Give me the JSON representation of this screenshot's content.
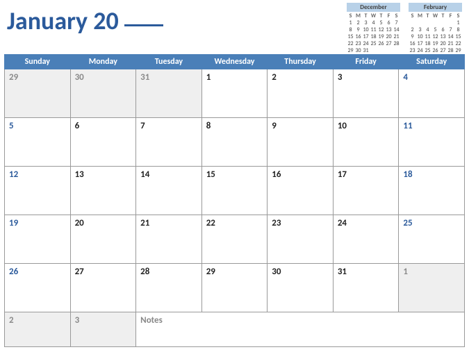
{
  "title_month": "January",
  "title_year_prefix": "20",
  "dow": [
    "Sunday",
    "Monday",
    "Tuesday",
    "Wednesday",
    "Thursday",
    "Friday",
    "Saturday"
  ],
  "dow_short": [
    "S",
    "M",
    "T",
    "W",
    "T",
    "F",
    "S"
  ],
  "weeks": [
    [
      {
        "n": "29",
        "t": "other"
      },
      {
        "n": "30",
        "t": "other"
      },
      {
        "n": "31",
        "t": "other"
      },
      {
        "n": "1",
        "t": "wkdy"
      },
      {
        "n": "2",
        "t": "wkdy"
      },
      {
        "n": "3",
        "t": "wkdy"
      },
      {
        "n": "4",
        "t": "wknd"
      }
    ],
    [
      {
        "n": "5",
        "t": "wknd"
      },
      {
        "n": "6",
        "t": "wkdy"
      },
      {
        "n": "7",
        "t": "wkdy"
      },
      {
        "n": "8",
        "t": "wkdy"
      },
      {
        "n": "9",
        "t": "wkdy"
      },
      {
        "n": "10",
        "t": "wkdy"
      },
      {
        "n": "11",
        "t": "wknd"
      }
    ],
    [
      {
        "n": "12",
        "t": "wknd"
      },
      {
        "n": "13",
        "t": "wkdy"
      },
      {
        "n": "14",
        "t": "wkdy"
      },
      {
        "n": "15",
        "t": "wkdy"
      },
      {
        "n": "16",
        "t": "wkdy"
      },
      {
        "n": "17",
        "t": "wkdy"
      },
      {
        "n": "18",
        "t": "wknd"
      }
    ],
    [
      {
        "n": "19",
        "t": "wknd"
      },
      {
        "n": "20",
        "t": "wkdy"
      },
      {
        "n": "21",
        "t": "wkdy"
      },
      {
        "n": "22",
        "t": "wkdy"
      },
      {
        "n": "23",
        "t": "wkdy"
      },
      {
        "n": "24",
        "t": "wkdy"
      },
      {
        "n": "25",
        "t": "wknd"
      }
    ],
    [
      {
        "n": "26",
        "t": "wknd"
      },
      {
        "n": "27",
        "t": "wkdy"
      },
      {
        "n": "28",
        "t": "wkdy"
      },
      {
        "n": "29",
        "t": "wkdy"
      },
      {
        "n": "30",
        "t": "wkdy"
      },
      {
        "n": "31",
        "t": "wkdy"
      },
      {
        "n": "1",
        "t": "other"
      }
    ]
  ],
  "lastrow": [
    {
      "n": "2",
      "t": "other"
    },
    {
      "n": "3",
      "t": "other"
    }
  ],
  "notes_label": "Notes",
  "mini": [
    {
      "title": "December",
      "rows": [
        [
          "1",
          "2",
          "3",
          "4",
          "5",
          "6",
          "7"
        ],
        [
          "8",
          "9",
          "10",
          "11",
          "12",
          "13",
          "14"
        ],
        [
          "15",
          "16",
          "17",
          "18",
          "19",
          "20",
          "21"
        ],
        [
          "22",
          "23",
          "24",
          "25",
          "26",
          "27",
          "28"
        ],
        [
          "29",
          "30",
          "31",
          "",
          "",
          "",
          ""
        ]
      ]
    },
    {
      "title": "February",
      "rows": [
        [
          "",
          "",
          "",
          "",
          "",
          "",
          "1"
        ],
        [
          "2",
          "3",
          "4",
          "5",
          "6",
          "7",
          "8"
        ],
        [
          "9",
          "10",
          "11",
          "12",
          "13",
          "14",
          "15"
        ],
        [
          "16",
          "17",
          "18",
          "19",
          "20",
          "21",
          "22"
        ],
        [
          "23",
          "24",
          "25",
          "26",
          "27",
          "28",
          "29"
        ]
      ]
    }
  ]
}
